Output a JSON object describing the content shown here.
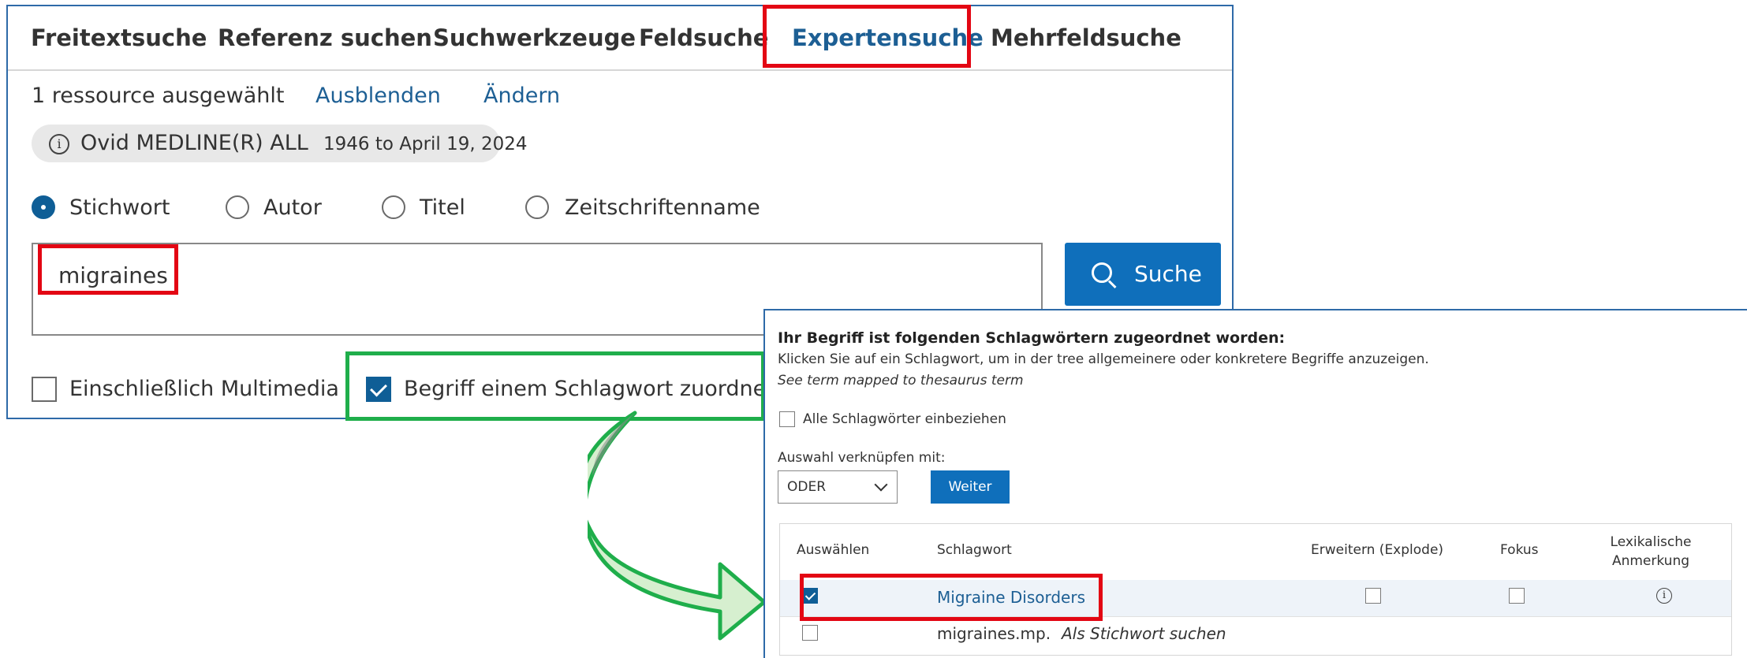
{
  "search_form": {
    "tabs": [
      "Freitextsuche",
      "Referenz suchen",
      "Suchwerkzeuge",
      "Feldsuche",
      "Expertensuche",
      "Mehrfeldsuche"
    ],
    "active_tab": "Expertensuche",
    "resources": {
      "selected_text": "1 ressource ausgewählt",
      "hide_link": "Ausblenden",
      "change_link": "Ändern",
      "database_name": "Ovid MEDLINE(R) ALL",
      "database_range": "1946 to April 19, 2024"
    },
    "search_fields": [
      {
        "label": "Stichwort",
        "selected": true
      },
      {
        "label": "Autor",
        "selected": false
      },
      {
        "label": "Titel",
        "selected": false
      },
      {
        "label": "Zeitschriftenname",
        "selected": false
      }
    ],
    "query": "migraines",
    "search_button": "Suche",
    "options": [
      {
        "label": "Einschließlich Multimedia",
        "checked": false
      },
      {
        "label": "Begriff einem Schlagwort zuordnen",
        "checked": true
      }
    ]
  },
  "mapping_panel": {
    "title": "Ihr Begriff ist folgenden Schlagwörtern zugeordnet worden:",
    "instruction": "Klicken Sie auf ein Schlagwort, um in der tree allgemeinere oder konkretere Begriffe anzuzeigen.",
    "see_also": "See term mapped to thesaurus term",
    "include_all_label": "Alle Schlagwörter einbeziehen",
    "combine_label": "Auswahl verknüpfen mit:",
    "combine_value": "ODER",
    "continue_button": "Weiter",
    "table": {
      "headers": [
        "Auswählen",
        "Schlagwort",
        "Erweitern (Explode)",
        "Fokus",
        "Lexikalische Anmerkung"
      ],
      "rows": [
        {
          "selected": true,
          "term": "Migraine Disorders",
          "explode": false,
          "focus": false,
          "has_scope_note": true
        },
        {
          "selected": false,
          "term": "migraines.mp.",
          "suffix": "Als Stichwort suchen"
        }
      ]
    }
  },
  "colors": {
    "accent_blue": "#0f6fbb",
    "link_blue": "#1d5f94",
    "highlight_red": "#e30613",
    "highlight_green": "#1fae4b",
    "arrow_fill": "#d6efcf"
  }
}
